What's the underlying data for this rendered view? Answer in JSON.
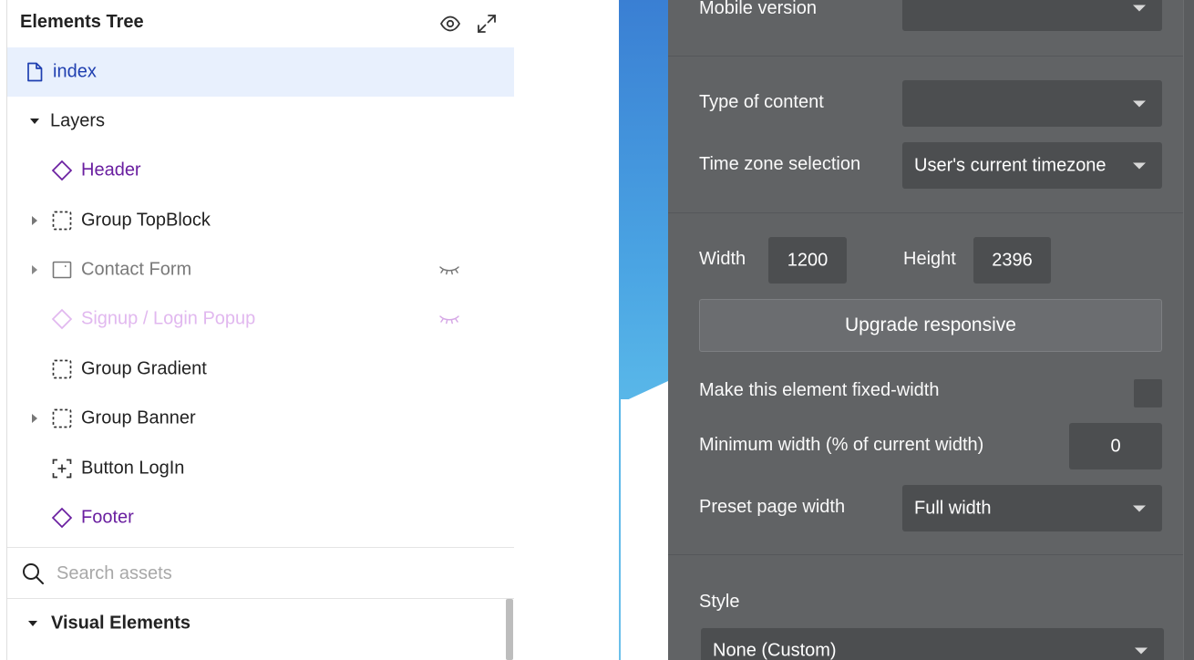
{
  "elements_tree": {
    "title": "Elements Tree",
    "page": {
      "label": "index"
    },
    "layers_label": "Layers",
    "items": [
      {
        "label": "Header"
      },
      {
        "label": "Group TopBlock"
      },
      {
        "label": "Contact Form"
      },
      {
        "label": "Signup / Login Popup"
      },
      {
        "label": "Group Gradient"
      },
      {
        "label": "Group Banner"
      },
      {
        "label": "Button LogIn"
      },
      {
        "label": "Footer"
      }
    ],
    "search": {
      "placeholder": "Search assets"
    },
    "visual_elements_label": "Visual Elements"
  },
  "property_panel": {
    "mobile_version": {
      "label": "Mobile version",
      "value": ""
    },
    "type_of_content": {
      "label": "Type of content",
      "value": ""
    },
    "time_zone": {
      "label": "Time zone selection",
      "value": "User's current timezone"
    },
    "width": {
      "label": "Width",
      "value": "1200"
    },
    "height": {
      "label": "Height",
      "value": "2396"
    },
    "upgrade_button": "Upgrade responsive",
    "fixed_width": {
      "label": "Make this element fixed-width",
      "checked": false
    },
    "min_width": {
      "label": "Minimum width (% of current width)",
      "value": "0"
    },
    "preset_width": {
      "label": "Preset page width",
      "value": "Full width"
    },
    "style": {
      "label": "Style",
      "value": "None (Custom)"
    }
  },
  "colors": {
    "selected_row_bg": "#e8f0fd",
    "page_link": "#1f3fb0",
    "reusable_purple": "#6a1fa0",
    "hidden_purple": "#e1b8ef",
    "panel_bg": "#616365",
    "field_bg": "#4c4e50"
  }
}
